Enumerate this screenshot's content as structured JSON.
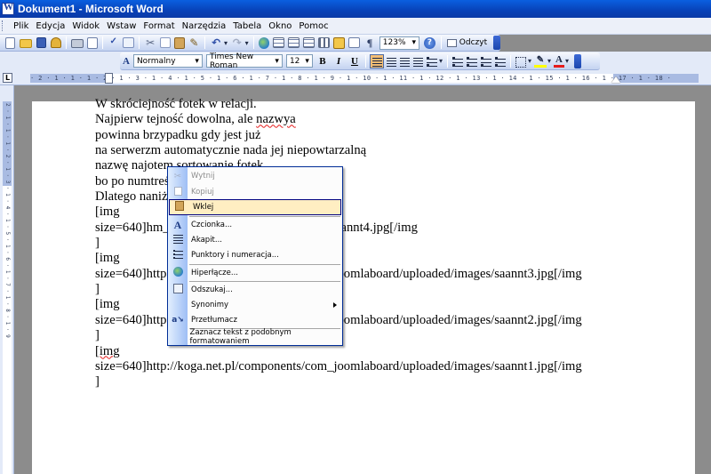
{
  "window": {
    "title": "Dokument1 - Microsoft Word"
  },
  "menubar": {
    "items": [
      "Plik",
      "Edycja",
      "Widok",
      "Wstaw",
      "Format",
      "Narzędzia",
      "Tabela",
      "Okno",
      "Pomoc"
    ]
  },
  "toolbar_standard": {
    "zoom": "123%",
    "read_label": "Odczyt"
  },
  "toolbar_format": {
    "style": "Normalny",
    "font": "Times New Roman",
    "size": "12",
    "bold": "B",
    "italic": "I",
    "underline": "U"
  },
  "ruler": {
    "numbers": "· 2 · 1 · 1 · 1 · 2 · 1 · 3 · 1 · 4 · 1 · 5 · 1 · 6 · 1 · 7 · 1 · 8 · 1 · 9 · 1 · 10 · 1 · 11 · 1 · 12 · 1 · 13 · 1 · 14 · 1 · 15 · 1 · 16 · 1 · 17 · 1 · 18 ·",
    "vertical_numbers": "2 · 1 · 1 · 1 · 2 · 1 · 3 · 1 · 4 · 1 · 5 · 1 · 6 · 1 · 7 · 1 · 8 · 1 · 9"
  },
  "document": {
    "lines": [
      [
        "W skróci",
        "",
        "ejność fotek w relacji."
      ],
      [
        "Najpierw t",
        "",
        "ejność dowolna, ale ",
        "nazwya"
      ],
      [
        "powinna b",
        "",
        "rzypadku gdy jest już"
      ],
      [
        "na serwerz",
        "",
        "m automatycznie nada jej niepowtarzalną"
      ],
      [
        "nazwę naj",
        "",
        "otem sortowanie fotek,"
      ],
      [
        "bo po num",
        "",
        "treścią fotki."
      ],
      [
        "Dlatego na",
        "",
        "niżej:"
      ],
      [
        "[img"
      ],
      [
        "size=640]h",
        "",
        "m_joomlaboard/uploaded/images/saannt4.jpg[/img"
      ],
      [
        "]"
      ],
      [
        "[img"
      ],
      [
        "size=640]http://koga.net.pl/components/com_joomlaboard/uploaded/images/saannt3.jpg[/img"
      ],
      [
        "]"
      ],
      [
        "[img"
      ],
      [
        "size=640]http://koga.net.pl/components/com_joomlaboard/uploaded/images/saannt2.jpg[/img"
      ],
      [
        "]"
      ],
      [
        "[img"
      ],
      [
        "size=640]http://koga.net.pl/components/com_joomlaboard/uploaded/images/saannt1.jpg[/img"
      ],
      [
        "]"
      ]
    ]
  },
  "context_menu": {
    "items": [
      {
        "label": "Wytnij",
        "icon": "scissors-icon",
        "disabled": true
      },
      {
        "label": "Kopiuj",
        "icon": "copy-icon",
        "disabled": true
      },
      {
        "label": "Wklej",
        "icon": "paste-icon",
        "highlighted": true
      },
      {
        "label": "Czcionka...",
        "icon": "font-icon"
      },
      {
        "label": "Akapit...",
        "icon": "paragraph-icon"
      },
      {
        "label": "Punktory i numeracja...",
        "icon": "bullets-icon"
      },
      {
        "label": "Hiperłącze...",
        "icon": "hyperlink-icon"
      },
      {
        "label": "Odszukaj...",
        "icon": "research-icon"
      },
      {
        "label": "Synonimy",
        "has_submenu": true
      },
      {
        "label": "Przetłumacz",
        "icon": "translate-icon"
      },
      {
        "label": "Zaznacz tekst z podobnym formatowaniem"
      }
    ]
  },
  "colors": {
    "titlebar": "#0842b8",
    "menu_highlight": "#ffeec2",
    "menu_highlight_border": "#000080",
    "spellcheck": "#e51c1c"
  }
}
